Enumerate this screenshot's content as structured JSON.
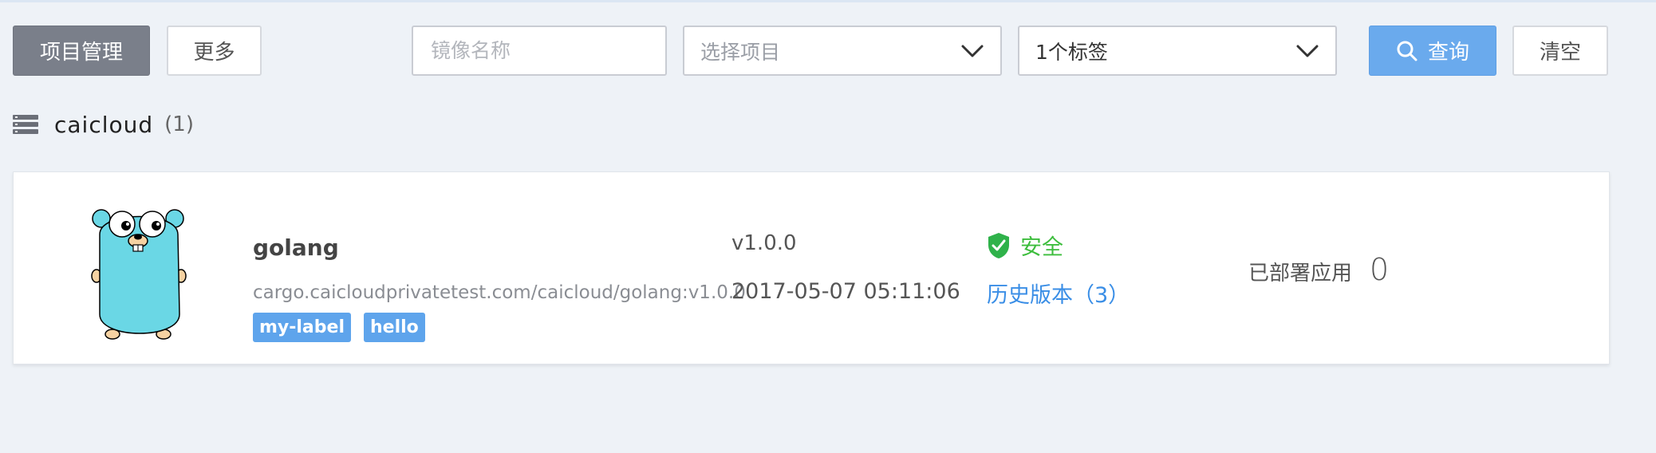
{
  "toolbar": {
    "project_mgmt_label": "项目管理",
    "more_label": "更多",
    "search_placeholder": "镜像名称",
    "project_select_value": "选择项目",
    "tag_select_value": "1个标签",
    "query_label": "查询",
    "clear_label": "清空"
  },
  "group": {
    "name": "caicloud",
    "count": "(1)"
  },
  "image": {
    "name": "golang",
    "path": "cargo.caicloudprivatetest.com/caicloud/golang:v1.0.0",
    "labels": [
      "my-label",
      "hello"
    ],
    "version": "v1.0.0",
    "timestamp": "2017-05-07 05:11:06",
    "security": "安全",
    "history": "历史版本（3）",
    "deployed_label": "已部署应用",
    "deployed_count": "0"
  },
  "colors": {
    "primary": "#6aaaed",
    "safe": "#3dbd3d",
    "link": "#3a8ee6",
    "tag": "#5ea4ec"
  },
  "icons": [
    "search-icon",
    "chevron-down-icon",
    "server-stack-icon",
    "shield-check-icon",
    "gopher-logo"
  ]
}
